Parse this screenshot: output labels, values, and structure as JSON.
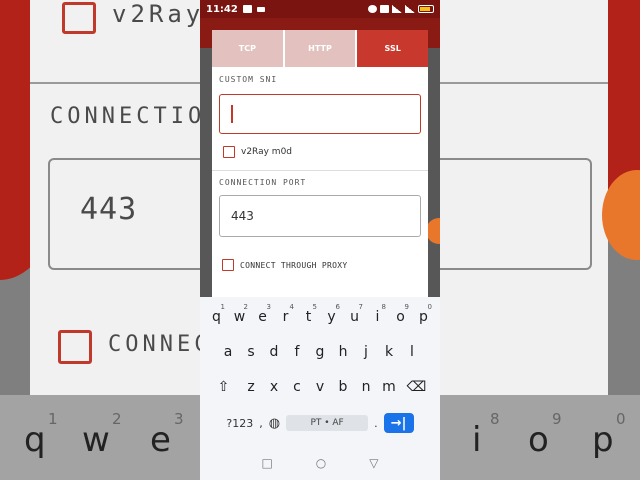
{
  "status": {
    "time": "11:42",
    "battery": ""
  },
  "tabs": [
    {
      "label": "TCP",
      "active": false
    },
    {
      "label": "HTTP",
      "active": false
    },
    {
      "label": "SSL",
      "active": true
    }
  ],
  "custom_sni": {
    "label": "CUSTOM SNI",
    "value": ""
  },
  "v2ray_checkbox": {
    "label": "v2Ray m0d",
    "checked": false
  },
  "connection_port": {
    "label": "CONNECTION PORT",
    "value": "443"
  },
  "proxy_checkbox": {
    "label": "CONNECT THROUGH PROXY",
    "checked": false
  },
  "keyboard": {
    "row1": [
      "q",
      "w",
      "e",
      "r",
      "t",
      "y",
      "u",
      "i",
      "o",
      "p"
    ],
    "row1_nums": [
      "1",
      "2",
      "3",
      "4",
      "5",
      "6",
      "7",
      "8",
      "9",
      "0"
    ],
    "row2": [
      "a",
      "s",
      "d",
      "f",
      "g",
      "h",
      "j",
      "k",
      "l"
    ],
    "row3": [
      "z",
      "x",
      "c",
      "v",
      "b",
      "n",
      "m"
    ],
    "sym_label": "?123",
    "comma": ",",
    "space_label": "PT • AF",
    "period": "."
  },
  "background": {
    "left_top_text": "v2Ray m",
    "left_connection": "CONNECTIO",
    "left_port": "443",
    "left_connect": "CONNEC",
    "left_keys": [
      "q",
      "w",
      "e"
    ],
    "left_nums": [
      "1",
      "2",
      "3"
    ],
    "right_keys": [
      "i",
      "o",
      "p"
    ],
    "right_nums": [
      "8",
      "9",
      "0"
    ]
  },
  "colors": {
    "accent": "#c8382c",
    "tab_inactive": "#e2c1be",
    "enter_key": "#1a73e8"
  }
}
